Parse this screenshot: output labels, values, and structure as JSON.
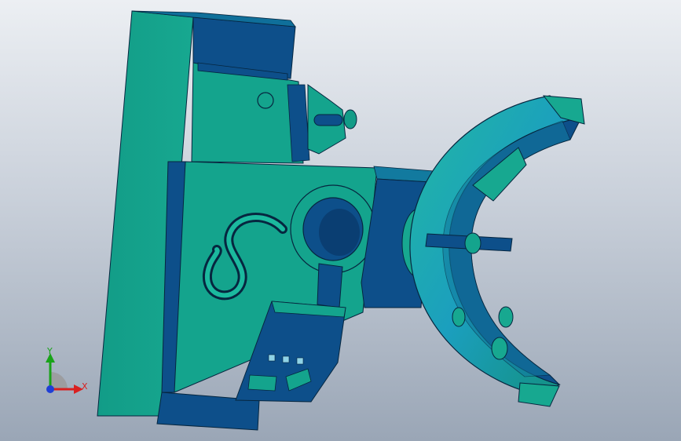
{
  "viewport": {
    "model": "3d-cad-assembly"
  },
  "triad": {
    "x_label": "X",
    "y_label": "Y"
  },
  "colors": {
    "teal_face": "#14a48d",
    "dark_face": "#0d4f8a",
    "mid_face": "#127a9f",
    "edge": "#06263f",
    "background_top": "#eceff3",
    "background_bottom": "#9aa6b6",
    "axis_x": "#d92020",
    "axis_y": "#19a319",
    "axis_z": "#1f3fd6"
  }
}
